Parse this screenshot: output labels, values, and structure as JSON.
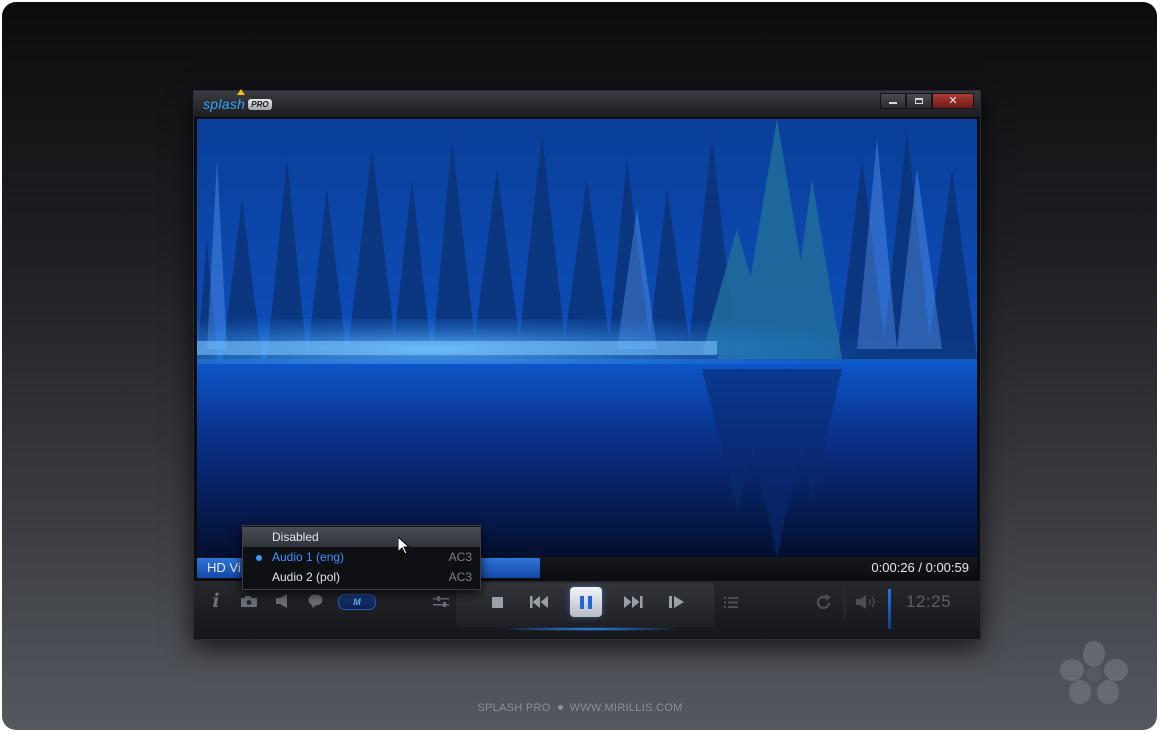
{
  "app": {
    "logo_text": "splash",
    "logo_badge": "PRO"
  },
  "window_buttons": {
    "minimize": "minimize-icon",
    "maximize": "maximize-icon",
    "close": "✕"
  },
  "video": {
    "scene": "misty blue forest lake"
  },
  "seek": {
    "label": "HD Vi",
    "position": "0:00:26",
    "duration": "0:00:59",
    "time_text": "0:00:26 / 0:00:59",
    "progress": 0.44
  },
  "audio_menu": {
    "items": [
      {
        "label": "Disabled",
        "codec": "",
        "selected": false
      },
      {
        "label": "Audio 1 (eng)",
        "codec": "AC3",
        "selected": true
      },
      {
        "label": "Audio 2 (pol)",
        "codec": "AC3",
        "selected": false
      }
    ]
  },
  "controls": {
    "info": "i",
    "m_label": "M",
    "clock": "12:25",
    "volume": 1.0,
    "icons": [
      "info-icon",
      "camera-icon",
      "speaker-icon",
      "subtitle-bubble-icon",
      "equalizer-icon",
      "stop-icon",
      "previous-icon",
      "pause-icon",
      "next-icon",
      "step-forward-icon",
      "playlist-icon",
      "repeat-icon",
      "volume-icon"
    ]
  },
  "footer": {
    "left": "SPLASH PRO",
    "right": "WWW.MIRILLIS.COM"
  },
  "colors": {
    "accent": "#2f8cff",
    "close": "#b03a34",
    "text_active": "#3b97ff"
  }
}
